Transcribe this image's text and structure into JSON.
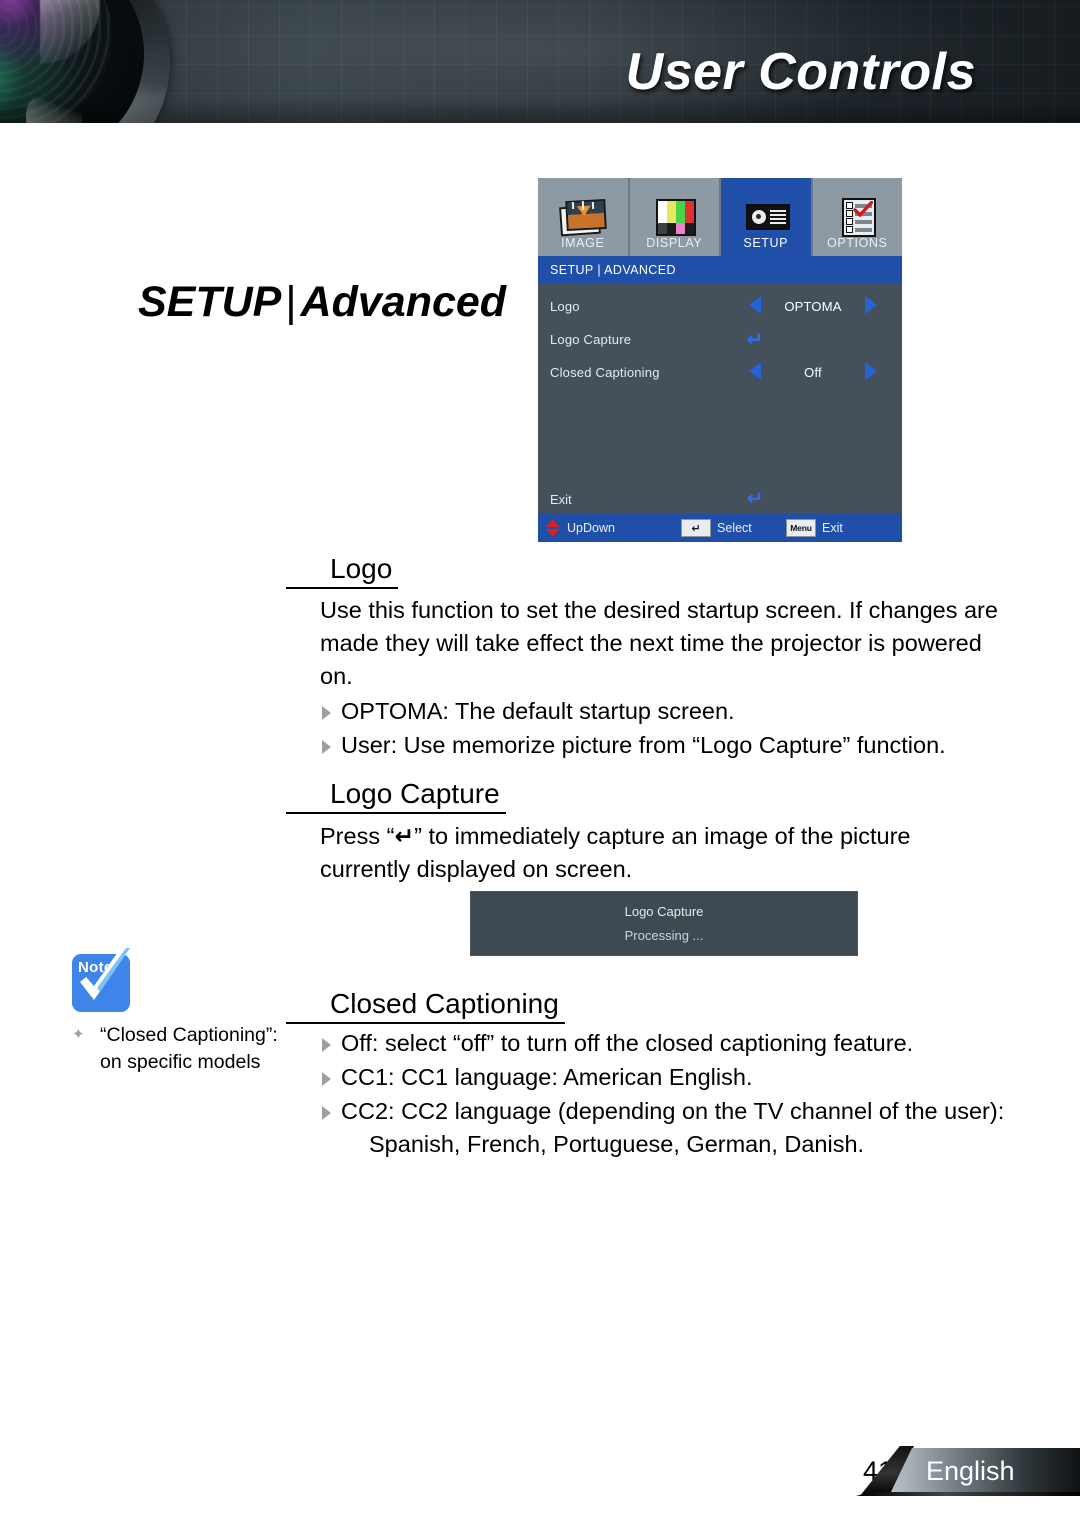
{
  "header": {
    "title": "User Controls",
    "lens_icon": "projector-lens-photo"
  },
  "page_title": {
    "section": "SETUP",
    "separator": "|",
    "subsection": "Advanced"
  },
  "osd": {
    "tabs": [
      {
        "label": "IMAGE",
        "icon": "image-icon",
        "active": false
      },
      {
        "label": "DISPLAY",
        "icon": "display-icon",
        "active": false
      },
      {
        "label": "SETUP",
        "icon": "setup-icon",
        "active": true
      },
      {
        "label": "OPTIONS",
        "icon": "options-icon",
        "active": false
      }
    ],
    "path": "SETUP | ADVANCED",
    "rows": [
      {
        "label": "Logo",
        "value": "OPTOMA",
        "control": "arrows"
      },
      {
        "label": "Logo Capture",
        "value": "",
        "control": "enter"
      },
      {
        "label": "Closed Captioning",
        "value": "Off",
        "control": "arrows"
      }
    ],
    "exit_label": "Exit",
    "exit_icon": "enter-key-icon",
    "footer": [
      {
        "icon": "updown-arrows-icon",
        "label": "UpDown"
      },
      {
        "icon": "enter-key-icon",
        "label": "Select",
        "key": "↵"
      },
      {
        "icon": "menu-key-icon",
        "label": "Exit",
        "key": "Menu"
      }
    ],
    "colors": {
      "panel_bg": "#44505a",
      "header_blue": "#1f4fa8",
      "tab_bg": "#8d99a3",
      "arrow_blue": "#2563d6",
      "updown_red": "#d92121"
    }
  },
  "sections": [
    {
      "heading": "Logo",
      "paragraph": "Use this function to set the desired startup screen. If changes are made they will take effect the next time the projector is powered on.",
      "bullets": [
        "OPTOMA: The default startup screen.",
        "User: Use memorize picture from “Logo Capture” function."
      ]
    },
    {
      "heading": "Logo Capture",
      "paragraph_pre": "Press “",
      "paragraph_key": "↵",
      "paragraph_post": "” to immediately capture an image of the picture currently displayed on screen."
    },
    {
      "heading": "Closed Captioning",
      "bullets": [
        {
          "text": "Off: select “off” to turn off the closed captioning feature."
        },
        {
          "text": "CC1: CC1 language: American English."
        },
        {
          "text": "CC2: CC2 language (depending on the TV channel of the user):",
          "continuation": "Spanish, French, Portuguese, German, Danish."
        }
      ]
    }
  ],
  "capture_dialog": {
    "title": "Logo Capture",
    "status": "Processing ..."
  },
  "note": {
    "badge": "Note",
    "icon": "note-check-icon",
    "line1": "“Closed Captioning”:",
    "line2": "on specific models"
  },
  "footer": {
    "page_number": "41",
    "language": "English"
  }
}
